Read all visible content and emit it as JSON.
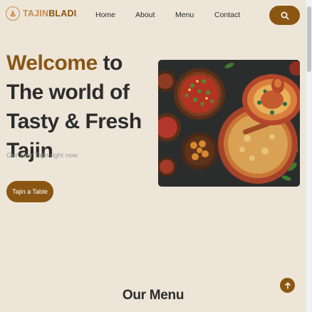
{
  "brand": {
    "name_part1": "TAJIN",
    "name_part2": "BLADI"
  },
  "nav": {
    "home": "Home",
    "about": "About",
    "menu": "Menu",
    "contact": "Contact"
  },
  "hero": {
    "title_accent": "Welcome",
    "title_rest": "to The world of Tasty & Fresh Tajin",
    "subtitle": "Get Your Tajin right now",
    "cta": "Tajin a Table"
  },
  "section": {
    "title": "Our Menu"
  },
  "colors": {
    "accent": "#8a5612",
    "logo_light": "#c98a4b",
    "background": "#ede6d8"
  },
  "icons": {
    "logo": "tajine-pot-icon",
    "search": "search-icon",
    "scroll_top": "arrow-up-icon"
  }
}
